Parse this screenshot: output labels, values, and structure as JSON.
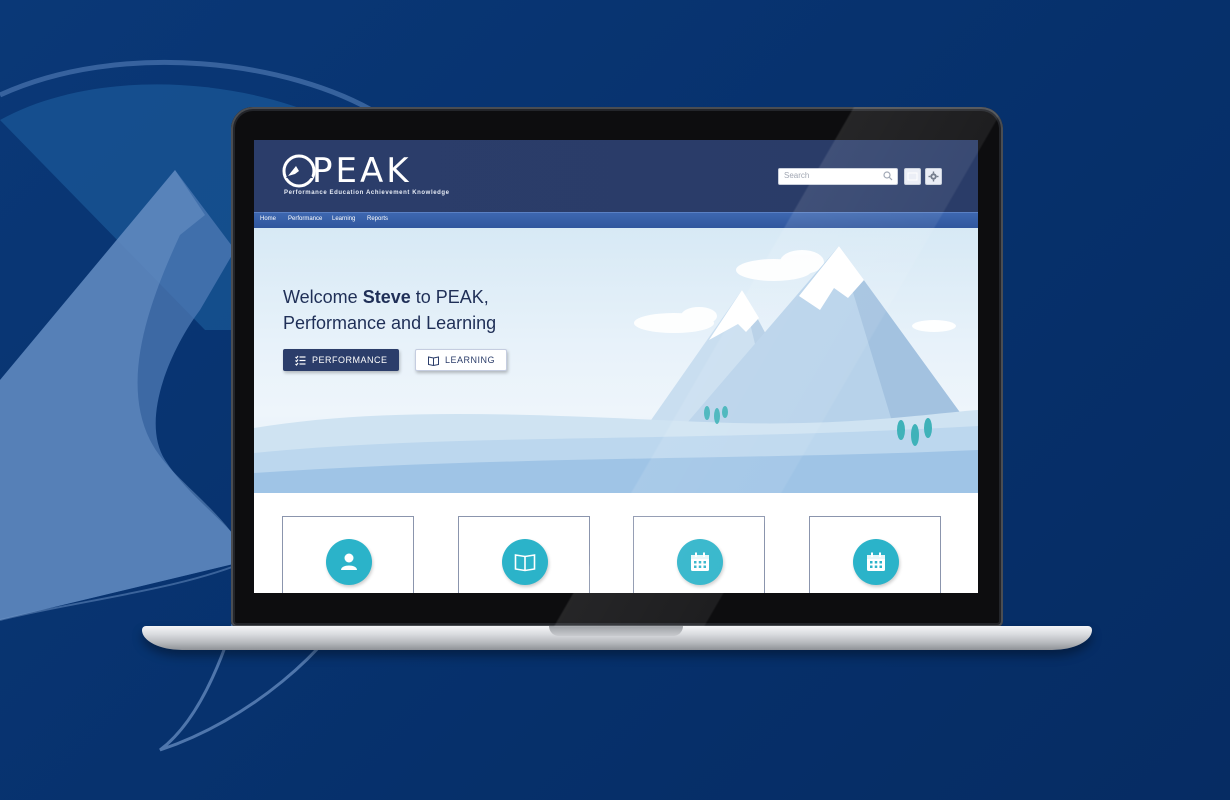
{
  "app": {
    "logo_text": "PEAK",
    "tagline": "Performance Education Achievement Knowledge"
  },
  "header": {
    "search_placeholder": "Search",
    "icons": [
      "search-icon",
      "inbox-icon",
      "gear-icon"
    ]
  },
  "nav": {
    "items": [
      {
        "label": "Home"
      },
      {
        "label": "Performance"
      },
      {
        "label": "Learning"
      },
      {
        "label": "Reports"
      }
    ]
  },
  "hero": {
    "welcome_prefix": "Welcome ",
    "user_name": "Steve",
    "welcome_suffix": " to PEAK,",
    "line2": "Performance and Learning",
    "buttons": [
      {
        "label": "PERFORMANCE",
        "icon": "checklist-icon"
      },
      {
        "label": "LEARNING",
        "icon": "book-icon"
      }
    ]
  },
  "cards": [
    {
      "icon": "user-icon"
    },
    {
      "icon": "book-icon"
    },
    {
      "icon": "calendar-icon"
    },
    {
      "icon": "calendar-icon"
    }
  ],
  "colors": {
    "background": "#08336f",
    "header": "#2b3d6a",
    "nav": "#3560a8",
    "accent": "#2bb3c9",
    "text_dark": "#1f2f57"
  }
}
